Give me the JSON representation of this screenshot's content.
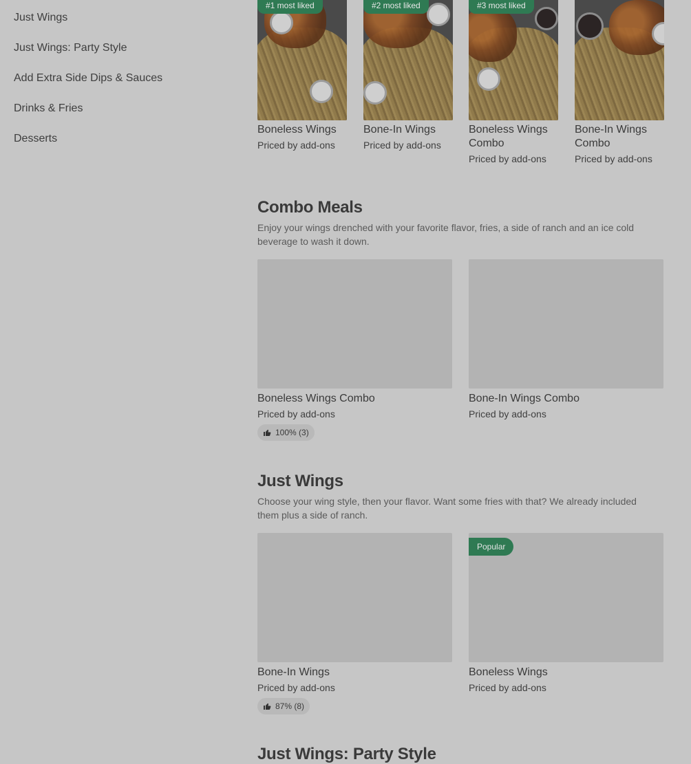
{
  "sidebar": {
    "items": [
      {
        "label": "Just Wings"
      },
      {
        "label": "Just Wings: Party Style"
      },
      {
        "label": "Add Extra Side Dips & Sauces"
      },
      {
        "label": "Drinks & Fries"
      },
      {
        "label": "Desserts"
      }
    ]
  },
  "featured": {
    "items": [
      {
        "badge": "#1 most liked",
        "name": "Boneless Wings",
        "price": "Priced by add-ons"
      },
      {
        "badge": "#2 most liked",
        "name": "Bone-In Wings",
        "price": "Priced by add-ons"
      },
      {
        "badge": "#3 most liked",
        "name": "Boneless Wings Combo",
        "price": "Priced by add-ons"
      },
      {
        "badge": "",
        "name": "Bone-In Wings Combo",
        "price": "Priced by add-ons"
      }
    ]
  },
  "combo": {
    "title": "Combo Meals",
    "description": "Enjoy your wings drenched with your favorite flavor, fries, a side of ranch and an ice cold beverage to wash it down.",
    "items": [
      {
        "name": "Boneless Wings Combo",
        "price": "Priced by add-ons",
        "rating": "100% (3)"
      },
      {
        "name": "Bone-In Wings Combo",
        "price": "Priced by add-ons"
      }
    ]
  },
  "justwings": {
    "title": "Just Wings",
    "description": "Choose your wing style, then your flavor. Want some fries with that? We already included them plus a side of ranch.",
    "items": [
      {
        "name": "Bone-In Wings",
        "price": "Priced by add-ons",
        "rating": "87% (8)"
      },
      {
        "name": "Boneless Wings",
        "price": "Priced by add-ons",
        "badge": "Popular"
      }
    ]
  },
  "party": {
    "title": "Just Wings: Party Style"
  },
  "colors": {
    "background": "#c6c6c6",
    "badge": "#2f7a53"
  },
  "icons": {
    "rating": "thumbs-up-icon"
  }
}
